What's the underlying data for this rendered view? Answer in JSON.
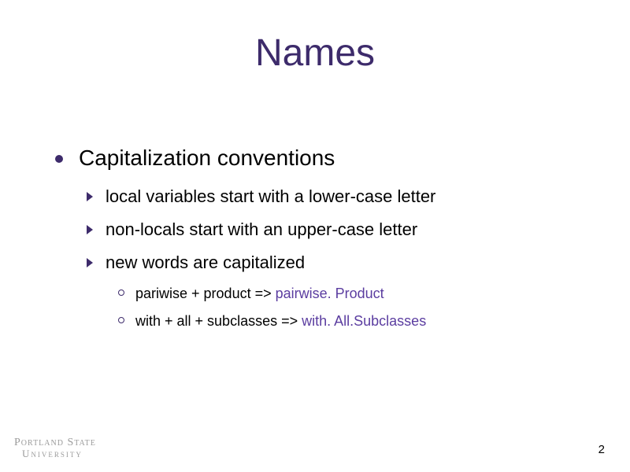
{
  "title": "Names",
  "bullets": {
    "level1": "Capitalization conventions",
    "level2": {
      "item0": "local variables start with a lower-case letter",
      "item1": "non-locals start with an upper-case letter",
      "item2": "new words are capitalized"
    },
    "level3": {
      "item0_prefix": "pariwise + product => ",
      "item0_accent": "pairwise. Product",
      "item1_prefix": "with + all + subclasses => ",
      "item1_accent": "with. All.Subclasses"
    }
  },
  "footer": {
    "logo_line1": "Portland State",
    "logo_line2": "University"
  },
  "page_number": "2"
}
